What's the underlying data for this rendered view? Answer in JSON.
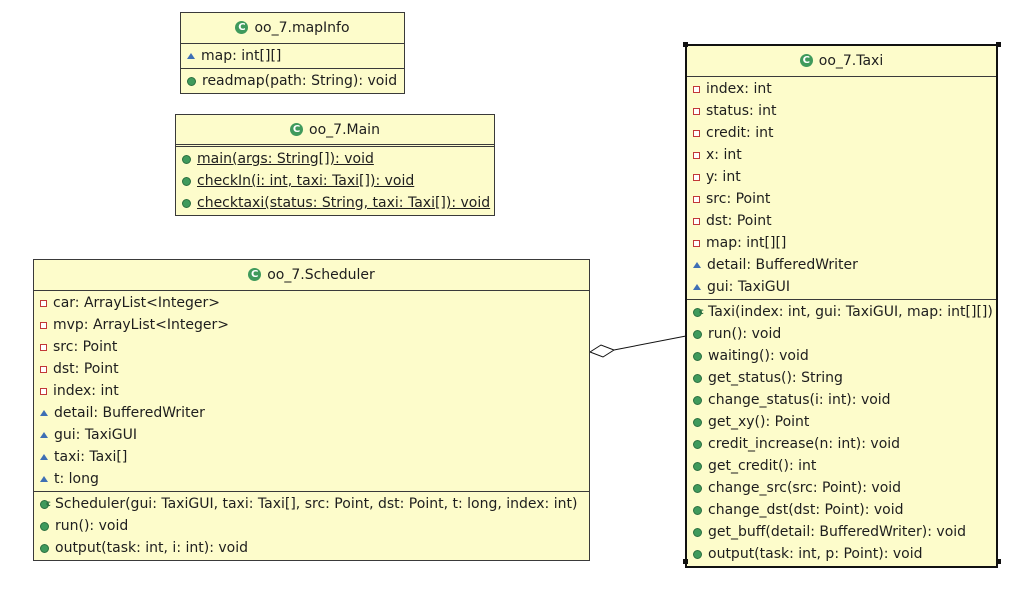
{
  "classes": {
    "mapinfo": {
      "name": "oo_7.mapInfo",
      "attributes": [
        {
          "vis": "package",
          "text": "map: int[][]"
        }
      ],
      "operations": [
        {
          "vis": "public",
          "text": "readmap(path: String): void"
        }
      ]
    },
    "main": {
      "name": "oo_7.Main",
      "attributes": [],
      "operations": [
        {
          "vis": "public",
          "text": "main(args: String[]): void",
          "static": true
        },
        {
          "vis": "public",
          "text": "checkIn(i: int, taxi: Taxi[]): void",
          "static": true
        },
        {
          "vis": "public",
          "text": "checktaxi(status: String, taxi: Taxi[]): void",
          "static": true
        }
      ]
    },
    "scheduler": {
      "name": "oo_7.Scheduler",
      "attributes": [
        {
          "vis": "private",
          "text": "car: ArrayList<Integer>"
        },
        {
          "vis": "private",
          "text": "mvp: ArrayList<Integer>"
        },
        {
          "vis": "private",
          "text": "src: Point"
        },
        {
          "vis": "private",
          "text": "dst: Point"
        },
        {
          "vis": "private",
          "text": "index: int"
        },
        {
          "vis": "package",
          "text": "detail: BufferedWriter"
        },
        {
          "vis": "package",
          "text": "gui: TaxiGUI"
        },
        {
          "vis": "package",
          "text": "taxi: Taxi[]"
        },
        {
          "vis": "package",
          "text": "t: long"
        }
      ],
      "operations": [
        {
          "vis": "constructor",
          "text": "Scheduler(gui: TaxiGUI, taxi: Taxi[], src: Point, dst: Point, t: long, index: int)"
        },
        {
          "vis": "public",
          "text": "run(): void"
        },
        {
          "vis": "public",
          "text": "output(task: int, i: int): void"
        }
      ]
    },
    "taxi": {
      "name": "oo_7.Taxi",
      "attributes": [
        {
          "vis": "private",
          "text": "index: int"
        },
        {
          "vis": "private",
          "text": "status: int"
        },
        {
          "vis": "private",
          "text": "credit: int"
        },
        {
          "vis": "private",
          "text": "x: int"
        },
        {
          "vis": "private",
          "text": "y: int"
        },
        {
          "vis": "private",
          "text": "src: Point"
        },
        {
          "vis": "private",
          "text": "dst: Point"
        },
        {
          "vis": "private",
          "text": "map: int[][]"
        },
        {
          "vis": "package",
          "text": "detail: BufferedWriter"
        },
        {
          "vis": "package",
          "text": "gui: TaxiGUI"
        }
      ],
      "operations": [
        {
          "vis": "constructor",
          "text": "Taxi(index: int, gui: TaxiGUI, map: int[][])"
        },
        {
          "vis": "public",
          "text": "run(): void"
        },
        {
          "vis": "public",
          "text": "waiting(): void"
        },
        {
          "vis": "public",
          "text": "get_status(): String"
        },
        {
          "vis": "public",
          "text": "change_status(i: int): void"
        },
        {
          "vis": "public",
          "text": "get_xy(): Point"
        },
        {
          "vis": "public",
          "text": "credit_increase(n: int): void"
        },
        {
          "vis": "public",
          "text": "get_credit(): int"
        },
        {
          "vis": "public",
          "text": "change_src(src: Point): void"
        },
        {
          "vis": "public",
          "text": "change_dst(dst: Point): void"
        },
        {
          "vis": "public",
          "text": "get_buff(detail: BufferedWriter): void"
        },
        {
          "vis": "public",
          "text": "output(task: int, p: Point): void"
        }
      ]
    }
  },
  "relations": [
    {
      "from": "oo_7.Scheduler",
      "to": "oo_7.Taxi",
      "kind": "aggregation"
    }
  ],
  "colors": {
    "class_fill": "#fdfccb",
    "class_icon": "#3f9a5c",
    "private_marker": "#c23838",
    "package_marker": "#3e6fb5",
    "public_marker": "#3f9a5c"
  }
}
